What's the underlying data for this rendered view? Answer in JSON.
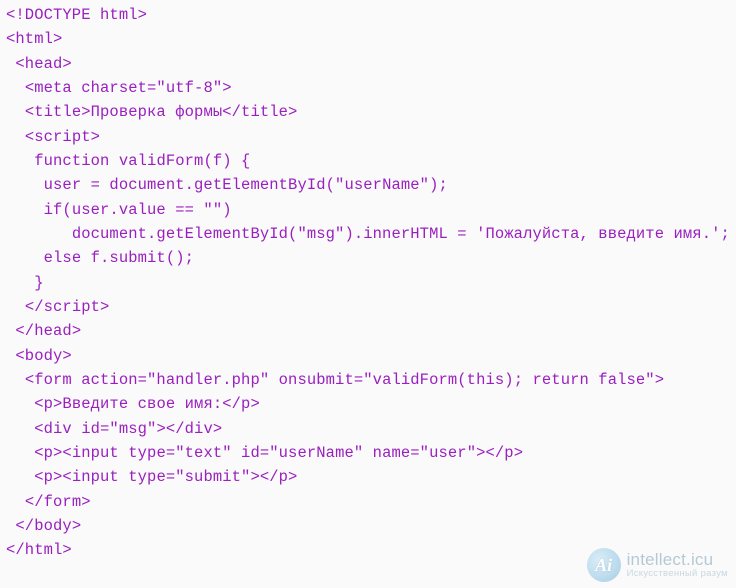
{
  "code": {
    "lines": [
      "<!DOCTYPE html>",
      "<html>",
      " <head>",
      "  <meta charset=\"utf-8\">",
      "  <title>Проверка формы</title>",
      "  <script>",
      "   function validForm(f) {",
      "    user = document.getElementById(\"userName\");",
      "    if(user.value == \"\")",
      "       document.getElementById(\"msg\").innerHTML = 'Пожалуйста, введите имя.';",
      "    else f.submit();",
      "   }",
      "  </script>",
      " </head>",
      " <body>",
      "  <form action=\"handler.php\" onsubmit=\"validForm(this); return false\">",
      "   <p>Введите свое имя:</p>",
      "   <div id=\"msg\"></div>",
      "   <p><input type=\"text\" id=\"userName\" name=\"user\"></p>",
      "   <p><input type=\"submit\"></p>",
      "  </form>",
      " </body>",
      "</html>"
    ]
  },
  "watermark": {
    "badge_text": "Ai",
    "title": "intellect.icu",
    "subtitle": "Искусственный разум"
  }
}
